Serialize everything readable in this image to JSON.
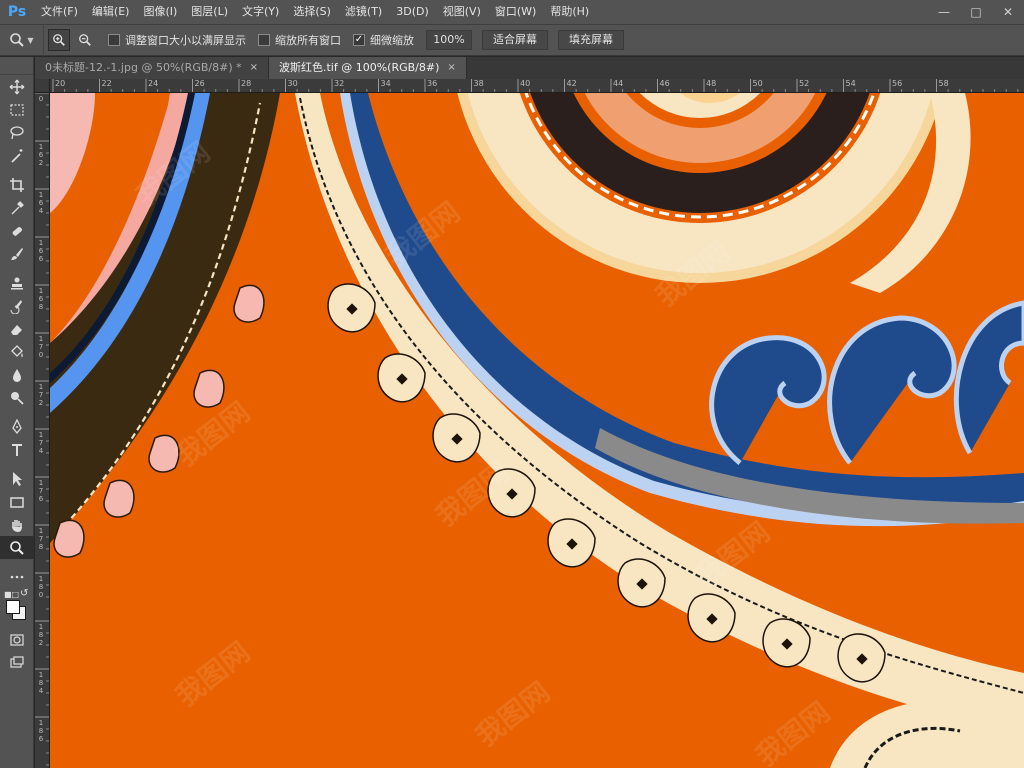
{
  "app": {
    "logo": "Ps"
  },
  "menu": [
    "文件(F)",
    "编辑(E)",
    "图像(I)",
    "图层(L)",
    "文字(Y)",
    "选择(S)",
    "滤镜(T)",
    "3D(D)",
    "视图(V)",
    "窗口(W)",
    "帮助(H)"
  ],
  "options": {
    "resize_windows_label": "调整窗口大小以满屏显示",
    "resize_windows_checked": false,
    "zoom_all_label": "缩放所有窗口",
    "zoom_all_checked": false,
    "scrubby_label": "细微缩放",
    "scrubby_checked": true,
    "zoom_value": "100%",
    "fit_screen_label": "适合屏幕",
    "fill_screen_label": "填充屏幕"
  },
  "tabs": [
    {
      "label": "0未标题-12.-1.jpg @ 50%(RGB/8#) *",
      "active": false
    },
    {
      "label": "波斯红色.tif @ 100%(RGB/8#)",
      "active": true
    }
  ],
  "ruler_h": [
    "20",
    "22",
    "24",
    "26",
    "28",
    "30",
    "32",
    "34",
    "36",
    "38",
    "40",
    "42",
    "44",
    "46",
    "48",
    "50",
    "52",
    "54",
    "56",
    "58"
  ],
  "ruler_v": [
    "0",
    "162",
    "164",
    "166",
    "168",
    "170",
    "172",
    "174",
    "176",
    "178",
    "180",
    "182",
    "184",
    "186"
  ],
  "tools": [
    "move-icon",
    "marquee-icon",
    "lasso-icon",
    "magic-wand-icon",
    "crop-icon",
    "eyedropper-icon",
    "healing-brush-icon",
    "brush-icon",
    "clone-stamp-icon",
    "history-brush-icon",
    "eraser-icon",
    "paint-bucket-icon",
    "blur-icon",
    "dodge-icon",
    "pen-icon",
    "type-icon",
    "path-selection-icon",
    "rectangle-icon",
    "hand-icon",
    "zoom-icon",
    "more-tools-icon"
  ],
  "active_tool": "zoom-icon",
  "colors": {
    "canvas_orange": "#e96000",
    "cream": "#f8e6c3",
    "navy": "#1f4a8c",
    "dark_brown": "#3b2a12",
    "pink": "#f5b9b1",
    "light_blue": "#bcd2f2"
  },
  "canvas": {
    "watermark": "我图网"
  }
}
